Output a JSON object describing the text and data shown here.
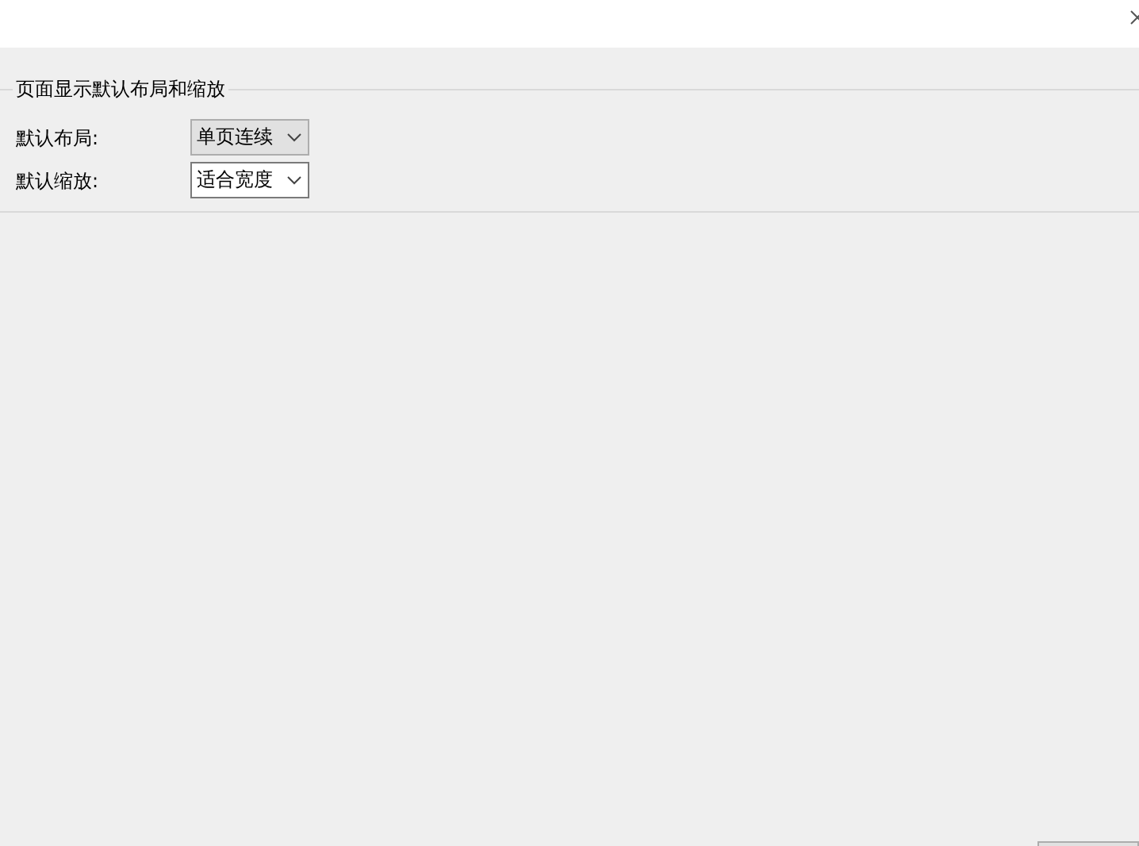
{
  "group": {
    "title": "页面显示默认布局和缩放",
    "settings": [
      {
        "label": "默认布局:",
        "value": "单页连续",
        "kind": "list"
      },
      {
        "label": "默认缩放:",
        "value": "适合宽度",
        "kind": "field"
      }
    ]
  }
}
